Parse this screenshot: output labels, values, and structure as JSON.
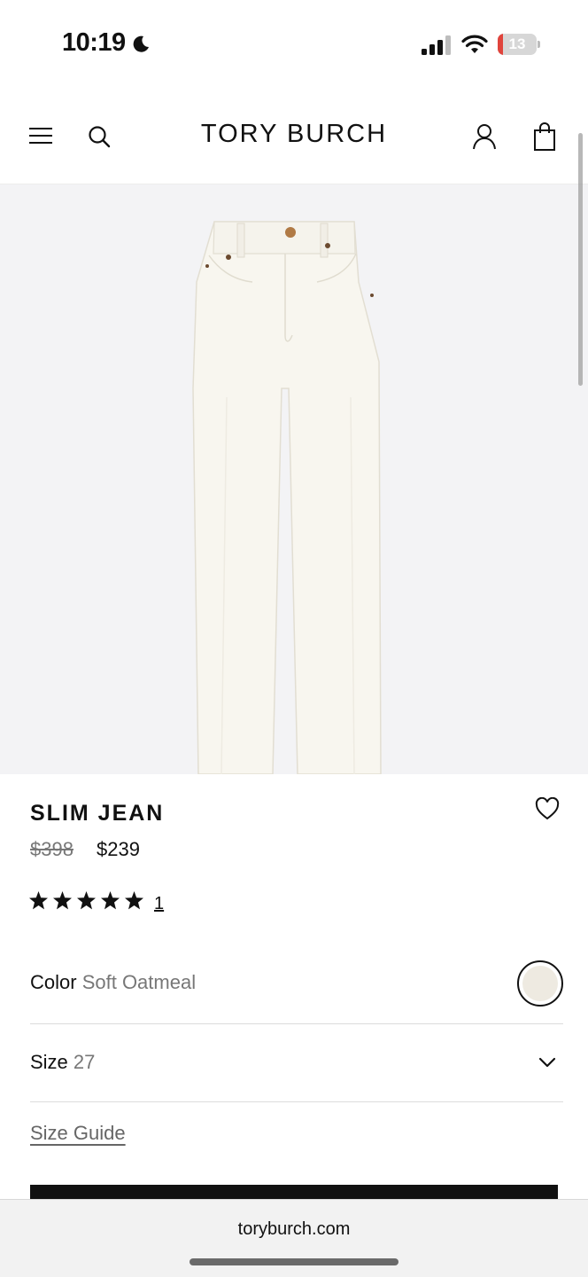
{
  "status_bar": {
    "time": "10:19",
    "battery_level": "13",
    "battery_fraction": 0.13,
    "icons": [
      "moon-icon",
      "signal-icon",
      "wifi-icon",
      "battery-icon"
    ]
  },
  "header": {
    "brand": "TORY BURCH",
    "icons": [
      "menu-icon",
      "search-icon",
      "account-icon",
      "bag-icon"
    ]
  },
  "product": {
    "image_icon": "jeans-image",
    "title": "SLIM JEAN",
    "price_original": "$398",
    "price_sale": "$239",
    "rating_stars": 5,
    "review_count": "1",
    "color_label": "Color",
    "color_value": "Soft Oatmeal",
    "swatch_color": "#eeeae1",
    "size_label": "Size",
    "size_value": "27",
    "size_guide": "Size Guide"
  },
  "browser": {
    "url": "toryburch.com"
  },
  "colors": {
    "accent": "#111111",
    "image_bg": "#f3f3f5",
    "battery_low": "#e0443c",
    "muted_text": "#777777"
  }
}
